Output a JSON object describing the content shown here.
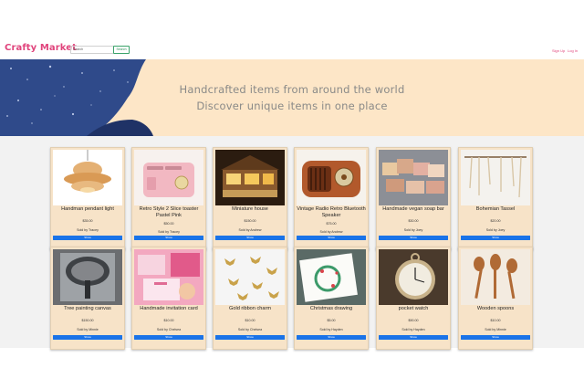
{
  "nav": {
    "brand": "Crafty Market",
    "search_placeholder": "Search",
    "search_button": "Search",
    "signup": "Sign Up",
    "login": "Log In"
  },
  "hero": {
    "line1": "Handcrafted items from around the world",
    "line2": "Discover unique items in one place"
  },
  "colors": {
    "brand_pink": "#e0447c",
    "hero_bg": "#fde6c7",
    "card_bg": "#f7e3c8",
    "button_blue": "#1a73e8"
  },
  "products": [
    {
      "title": "Handman pendant light",
      "price": "$35.00",
      "seller": "Sold by Tracey",
      "button": "Show"
    },
    {
      "title": "Retro Style 2 Slice toaster Pastel Pink",
      "price": "$50.00",
      "seller": "Sold by Tracey",
      "button": "Show"
    },
    {
      "title": "Miniature house",
      "price": "$150.00",
      "seller": "Sold by Andrew",
      "button": "Show"
    },
    {
      "title": "Vintage Radio Retro Bluetooth Speaker",
      "price": "$75.00",
      "seller": "Sold by Andrew",
      "button": "Show"
    },
    {
      "title": "Handmade vegan soap bar",
      "price": "$30.00",
      "seller": "Sold by Joey",
      "button": "Show"
    },
    {
      "title": "Bohemian Tassel",
      "price": "$20.00",
      "seller": "Sold by Joey",
      "button": "Show"
    },
    {
      "title": "Tree painting canvas",
      "price": "$150.00",
      "seller": "Sold by Minnie",
      "button": "Show"
    },
    {
      "title": "Handmade invitation card",
      "price": "$10.00",
      "seller": "Sold by Chelsea",
      "button": "Show"
    },
    {
      "title": "Gold ribbon charm",
      "price": "$10.00",
      "seller": "Sold by Chelsea",
      "button": "Show"
    },
    {
      "title": "Christmas drawing",
      "price": "$5.00",
      "seller": "Sold by Hayden",
      "button": "Show"
    },
    {
      "title": "pocket watch",
      "price": "$90.00",
      "seller": "Sold by Hayden",
      "button": "Show"
    },
    {
      "title": "Wooden spoons",
      "price": "$10.00",
      "seller": "Sold by Minnie",
      "button": "Show"
    }
  ]
}
